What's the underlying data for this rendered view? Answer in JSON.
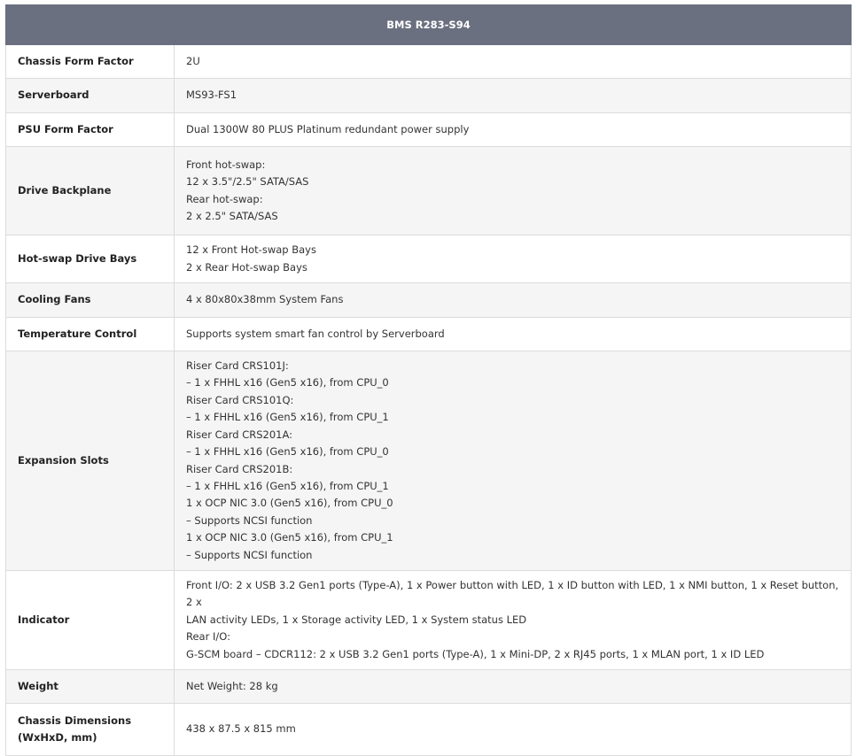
{
  "table": {
    "title": "BMS R283-S94",
    "rows": [
      {
        "label": [
          "Chassis Form Factor"
        ],
        "value": [
          "2U"
        ],
        "h": 38
      },
      {
        "label": [
          "Serverboard"
        ],
        "value": [
          "MS93-FS1"
        ],
        "h": 39
      },
      {
        "label": [
          "PSU Form Factor"
        ],
        "value": [
          "Dual 1300W 80 PLUS Platinum redundant power supply"
        ],
        "h": 38
      },
      {
        "label": [
          "Drive Backplane"
        ],
        "value": [
          "Front hot-swap:",
          "12 x 3.5\"/2.5\" SATA/SAS",
          "Rear hot-swap:",
          "2 x 2.5\" SATA/SAS"
        ],
        "h": 100
      },
      {
        "label": [
          "Hot-swap Drive Bays"
        ],
        "value": [
          "12 x Front Hot-swap Bays",
          "2 x Rear Hot-swap Bays"
        ],
        "h": 54
      },
      {
        "label": [
          "Cooling Fans"
        ],
        "value": [
          "4 x 80x80x38mm System Fans"
        ],
        "h": 39
      },
      {
        "label": [
          "Temperature Control"
        ],
        "value": [
          "Supports system smart fan control by Serverboard"
        ],
        "h": 38
      },
      {
        "label": [
          "Expansion Slots"
        ],
        "value": [
          "Riser Card CRS101J:",
          "– 1 x FHHL x16 (Gen5 x16), from CPU_0",
          "Riser Card CRS101Q:",
          "– 1 x FHHL x16 (Gen5 x16), from CPU_1",
          "Riser Card CRS201A:",
          "– 1 x FHHL x16 (Gen5 x16), from CPU_0",
          "Riser Card CRS201B:",
          "– 1 x FHHL x16 (Gen5 x16), from CPU_1",
          "1 x OCP NIC 3.0 (Gen5 x16), from CPU_0",
          "– Supports NCSI function",
          "1 x OCP NIC 3.0 (Gen5 x16), from CPU_1",
          "– Supports NCSI function"
        ],
        "h": 248
      },
      {
        "label": [
          "Indicator"
        ],
        "value": [
          "Front I/O: 2 x USB 3.2 Gen1 ports (Type-A), 1 x Power button with LED, 1 x ID button with LED, 1 x NMI button, 1 x Reset button, 2 x",
          "LAN activity LEDs, 1 x Storage activity LED, 1 x System status LED",
          "Rear I/O:",
          "G-SCM board – CDCR112: 2 x USB 3.2 Gen1 ports (Type-A), 1 x Mini-DP, 2 x RJ45 ports, 1 x MLAN port, 1 x ID LED"
        ],
        "h": 96
      },
      {
        "label": [
          "Weight"
        ],
        "value": [
          "Net Weight: 28 kg"
        ],
        "h": 38
      },
      {
        "label": [
          "Chassis Dimensions",
          "(WxHxD, mm)"
        ],
        "value": [
          "438 x 87.5 x 815 mm"
        ],
        "h": 59
      }
    ]
  }
}
